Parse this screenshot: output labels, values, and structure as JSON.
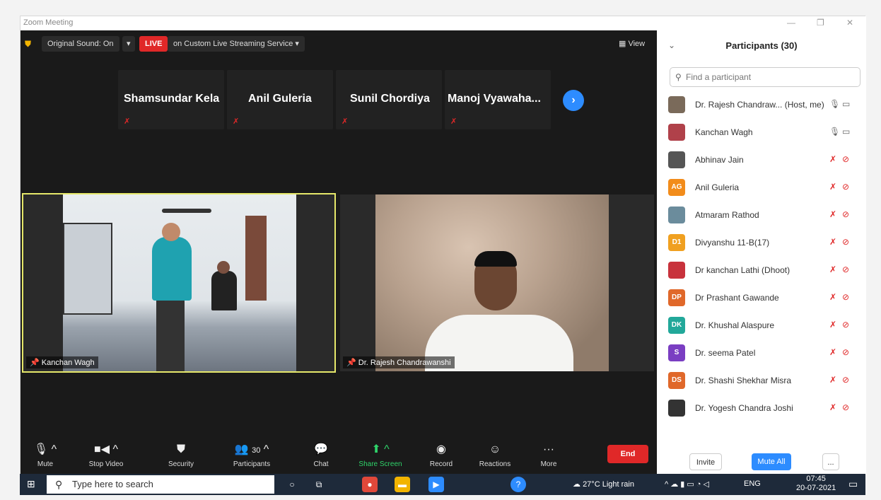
{
  "window": {
    "title": "Zoom Meeting"
  },
  "topbar": {
    "original_sound": "Original Sound: On",
    "live_badge": "LIVE",
    "live_service": "on Custom Live Streaming Service",
    "view_label": "View"
  },
  "name_tiles": [
    "Shamsundar Kela",
    "Anil Guleria",
    "Sunil Chordiya",
    "Manoj  Vyawaha..."
  ],
  "videos": {
    "left_name": "Kanchan Wagh",
    "right_name": "Dr. Rajesh Chandrawanshi"
  },
  "controls": {
    "mute": "Mute",
    "stop_video": "Stop Video",
    "security": "Security",
    "participants": "Participants",
    "participants_count": "30",
    "chat": "Chat",
    "share_screen": "Share Screen",
    "record": "Record",
    "reactions": "Reactions",
    "more": "More",
    "end": "End"
  },
  "panel": {
    "title": "Participants (30)",
    "search_placeholder": "Find a participant",
    "participants": [
      {
        "name": "Dr. Rajesh Chandraw...  (Host, me)",
        "initials": "",
        "color": "#7a6a5a",
        "muted": false
      },
      {
        "name": "Kanchan Wagh",
        "initials": "",
        "color": "#b0414a",
        "muted": false
      },
      {
        "name": "Abhinav Jain",
        "initials": "",
        "color": "#555555",
        "muted": true
      },
      {
        "name": "Anil Guleria",
        "initials": "AG",
        "color": "#f28c1b",
        "muted": true
      },
      {
        "name": "Atmaram Rathod",
        "initials": "",
        "color": "#6b8c9c",
        "muted": true
      },
      {
        "name": "Divyanshu 11-B(17)",
        "initials": "D1",
        "color": "#f0a020",
        "muted": true
      },
      {
        "name": "Dr kanchan Lathi (Dhoot)",
        "initials": "",
        "color": "#c8323c",
        "muted": true
      },
      {
        "name": "Dr Prashant Gawande",
        "initials": "DP",
        "color": "#e0682a",
        "muted": true
      },
      {
        "name": "Dr. Khushal Alaspure",
        "initials": "DK",
        "color": "#22a89a",
        "muted": true
      },
      {
        "name": "Dr. seema Patel",
        "initials": "S",
        "color": "#7a3ec2",
        "muted": true
      },
      {
        "name": "Dr. Shashi Shekhar Misra",
        "initials": "DS",
        "color": "#e0682a",
        "muted": true
      },
      {
        "name": "Dr. Yogesh Chandra Joshi",
        "initials": "",
        "color": "#333333",
        "muted": true
      }
    ],
    "invite": "Invite",
    "mute_all": "Mute All",
    "more": "..."
  },
  "taskbar": {
    "search_placeholder": "Type here to search",
    "weather": "27°C  Light rain",
    "lang": "ENG",
    "time": "07:45",
    "date": "20-07-2021"
  }
}
